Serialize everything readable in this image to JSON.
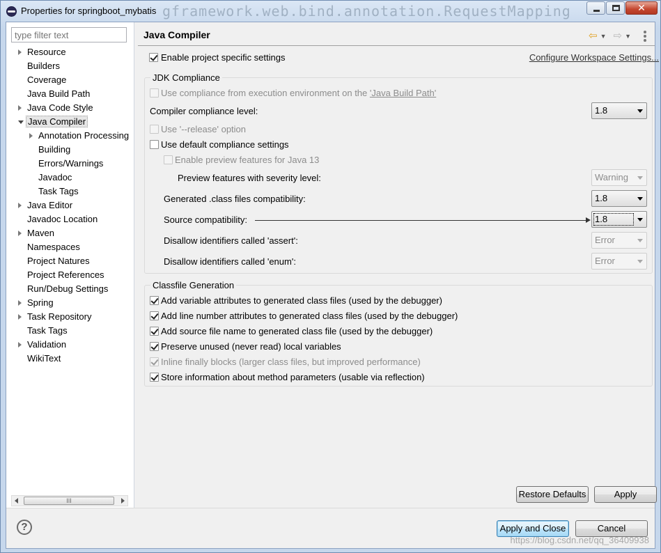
{
  "window": {
    "title": "Properties for springboot_mybatis",
    "ghost_title": "gframework.web.bind.annotation.RequestMapping",
    "close_glyph": "✕"
  },
  "filter": {
    "placeholder": "type filter text"
  },
  "tree": [
    {
      "label": "Resource",
      "expandable": true
    },
    {
      "label": "Builders"
    },
    {
      "label": "Coverage"
    },
    {
      "label": "Java Build Path"
    },
    {
      "label": "Java Code Style",
      "expandable": true
    },
    {
      "label": "Java Compiler",
      "expanded": true,
      "selected": true
    },
    {
      "label": "Annotation Processing",
      "expandable": true,
      "child": true
    },
    {
      "label": "Building",
      "child": true
    },
    {
      "label": "Errors/Warnings",
      "child": true
    },
    {
      "label": "Javadoc",
      "child": true
    },
    {
      "label": "Task Tags",
      "child": true
    },
    {
      "label": "Java Editor",
      "expandable": true
    },
    {
      "label": "Javadoc Location"
    },
    {
      "label": "Maven",
      "expandable": true
    },
    {
      "label": "Namespaces"
    },
    {
      "label": "Project Natures"
    },
    {
      "label": "Project References"
    },
    {
      "label": "Run/Debug Settings"
    },
    {
      "label": "Spring",
      "expandable": true
    },
    {
      "label": "Task Repository",
      "expandable": true
    },
    {
      "label": "Task Tags"
    },
    {
      "label": "Validation",
      "expandable": true
    },
    {
      "label": "WikiText"
    }
  ],
  "scrollbar": {
    "thumb_grip": "III"
  },
  "page": {
    "title": "Java Compiler",
    "enable_project_specific": {
      "label": "Enable project specific settings",
      "checked": true
    },
    "configure_link": "Configure Workspace Settings..."
  },
  "jdk": {
    "group_title": "JDK Compliance",
    "use_compliance": {
      "prefix": "Use compliance from execution environment on the ",
      "link": "'Java Build Path'",
      "checked": false,
      "enabled": false
    },
    "compiler_level": {
      "label": "Compiler compliance level:",
      "value": "1.8"
    },
    "release_option": {
      "label": "Use '--release' option",
      "checked": false,
      "enabled": false
    },
    "default_settings": {
      "label": "Use default compliance settings",
      "checked": false
    },
    "preview_features": {
      "label": "Enable preview features for Java 13",
      "checked": false,
      "enabled": false
    },
    "preview_severity": {
      "label": "Preview features with severity level:",
      "value": "Warning",
      "enabled": false
    },
    "class_compat": {
      "label": "Generated .class files compatibility:",
      "value": "1.8"
    },
    "source_compat": {
      "label": "Source compatibility:",
      "value": "1.8"
    },
    "assert_ident": {
      "label": "Disallow identifiers called 'assert':",
      "value": "Error",
      "enabled": false
    },
    "enum_ident": {
      "label": "Disallow identifiers called 'enum':",
      "value": "Error",
      "enabled": false
    }
  },
  "classfile": {
    "group_title": "Classfile Generation",
    "options": [
      {
        "label": "Add variable attributes to generated class files (used by the debugger)",
        "checked": true,
        "enabled": true
      },
      {
        "label": "Add line number attributes to generated class files (used by the debugger)",
        "checked": true,
        "enabled": true
      },
      {
        "label": "Add source file name to generated class file (used by the debugger)",
        "checked": true,
        "enabled": true
      },
      {
        "label": "Preserve unused (never read) local variables",
        "checked": true,
        "enabled": true
      },
      {
        "label": "Inline finally blocks (larger class files, but improved performance)",
        "checked": true,
        "enabled": false
      },
      {
        "label": "Store information about method parameters (usable via reflection)",
        "checked": true,
        "enabled": true
      }
    ]
  },
  "buttons": {
    "restore_defaults": "Restore Defaults",
    "apply": "Apply",
    "apply_and_close": "Apply and Close",
    "cancel": "Cancel"
  },
  "help": {
    "glyph": "?"
  },
  "watermark": "https://blog.csdn.net/qq_36409938"
}
